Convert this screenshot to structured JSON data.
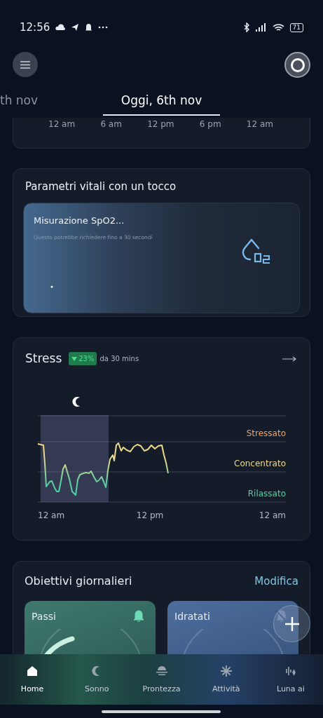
{
  "status_bar": {
    "time": "12:56",
    "battery": "71"
  },
  "date_tabs": [
    {
      "label": "th nov",
      "selected": false
    },
    {
      "label": "Oggi, 6th nov",
      "selected": true
    }
  ],
  "timeline_axis": [
    "12 am",
    "6 am",
    "12 pm",
    "6 pm",
    "12 am"
  ],
  "vitals": {
    "title": "Parametri vitali con un tocco",
    "measure_title": "Misurazione SpO2...",
    "measure_hint": "Questo potrebbe richiedere fino a 30 secondi"
  },
  "stress": {
    "title": "Stress",
    "change": "23%",
    "falling": true,
    "period": "da 30 mins",
    "levels": [
      {
        "label": "Stressato",
        "color": "#e9a466"
      },
      {
        "label": "Concentrato",
        "color": "#eed98a"
      },
      {
        "label": "Rilassato",
        "color": "#4fd1a0"
      }
    ],
    "x_labels": [
      "12 am",
      "12 pm",
      "12 am"
    ]
  },
  "goals": {
    "title": "Obiettivi giornalieri",
    "action": "Modifica",
    "items": [
      {
        "label": "Passi",
        "kind": "steps",
        "reminder": true
      },
      {
        "label": "Idratati",
        "kind": "water",
        "reminder": false
      }
    ]
  },
  "nav": [
    {
      "label": "Home",
      "kind": "home",
      "selected": true
    },
    {
      "label": "Sonno",
      "kind": "sleep",
      "selected": false
    },
    {
      "label": "Prontezza",
      "kind": "readiness",
      "selected": false
    },
    {
      "label": "Attività",
      "kind": "activity",
      "selected": false
    },
    {
      "label": "Luna ai",
      "kind": "assistant",
      "selected": false
    }
  ]
}
